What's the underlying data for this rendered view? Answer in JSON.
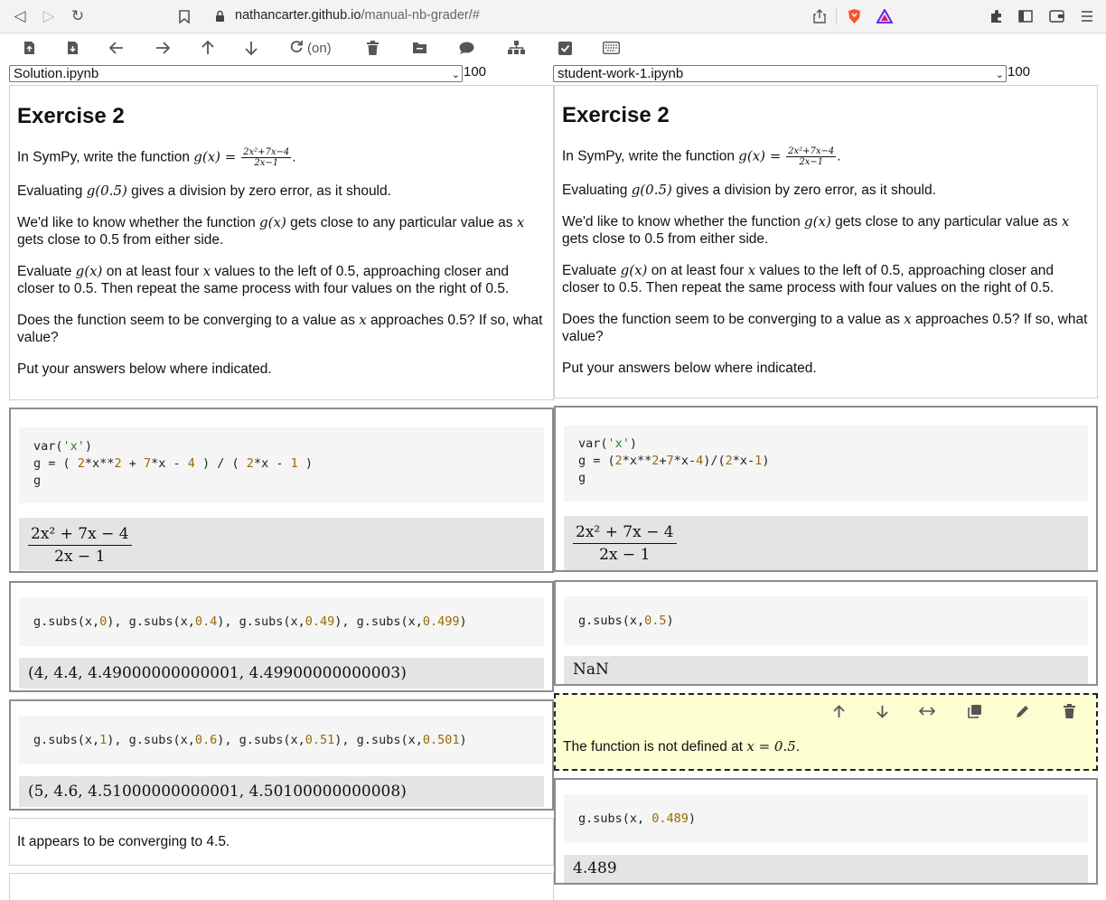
{
  "browser": {
    "url_host": "nathancarter.github.io",
    "url_path": "/manual-nb-grader/#"
  },
  "toolbar": {
    "autosave_label": "(on)"
  },
  "left_pane": {
    "notebook_file": "Solution.ipynb",
    "zoom": "100",
    "exercise": {
      "title": "Exercise 2",
      "p1_pre": "In SymPy, write the function ",
      "p1_fn": "g(x) = ",
      "p1_num": "2x²+7x−4",
      "p1_den": "2x−1",
      "p1_post": ".",
      "p2_pre": "Evaluating ",
      "p2_expr": "g(0.5)",
      "p2_post": " gives a division by zero error, as it should.",
      "p3_pre": "We'd like to know whether the function ",
      "p3_expr": "g(x)",
      "p3_mid": " gets close to any particular value as ",
      "p3_var": "x",
      "p3_post": " gets close to 0.5 from either side.",
      "p4_pre": "Evaluate ",
      "p4_expr": "g(x)",
      "p4_mid": " on at least four ",
      "p4_var": "x",
      "p4_post": " values to the left of 0.5, approaching closer and closer to 0.5. Then repeat the same process with four values on the right of 0.5.",
      "p5_pre": "Does the function seem to be converging to a value as ",
      "p5_var": "x",
      "p5_post": " approaches 0.5? If so, what value?",
      "p6": "Put your answers below where indicated."
    },
    "code1": {
      "line1_a": "var(",
      "line1_b": "'x'",
      "line1_c": ")",
      "line2_a": "g = ( ",
      "line2_b": "2",
      "line2_c": "*x**",
      "line2_d": "2",
      "line2_e": " + ",
      "line2_f": "7",
      "line2_g": "*x - ",
      "line2_h": "4",
      "line2_i": " ) / ( ",
      "line2_j": "2",
      "line2_k": "*x - ",
      "line2_l": "1",
      "line2_m": " )",
      "line3": "g",
      "out_num": "2x² + 7x − 4",
      "out_den": "2x − 1"
    },
    "code2": {
      "a": "g.subs(x,",
      "b": "0",
      "c": "), g.subs(x,",
      "d": "0.4",
      "e": "), g.subs(x,",
      "f": "0.49",
      "g": "), g.subs(x,",
      "h": "0.499",
      "i": ")",
      "out": "(4,  4.4,  4.49000000000001,  4.49900000000003)"
    },
    "code3": {
      "a": "g.subs(x,",
      "b": "1",
      "c": "), g.subs(x,",
      "d": "0.6",
      "e": "), g.subs(x,",
      "f": "0.51",
      "g": "), g.subs(x,",
      "h": "0.501",
      "i": ")",
      "out": "(5,  4.6,  4.51000000000001,  4.50100000000008)"
    },
    "answer_text": "It appears to be converging to 4.5."
  },
  "right_pane": {
    "notebook_file": "student-work-1.ipynb",
    "zoom": "100",
    "exercise": {
      "title": "Exercise 2",
      "p1_pre": "In SymPy, write the function ",
      "p1_fn": "g(x) = ",
      "p1_num": "2x²+7x−4",
      "p1_den": "2x−1",
      "p1_post": ".",
      "p2_pre": "Evaluating ",
      "p2_expr": "g(0.5)",
      "p2_post": " gives a division by zero error, as it should.",
      "p3_pre": "We'd like to know whether the function ",
      "p3_expr": "g(x)",
      "p3_mid": " gets close to any particular value as ",
      "p3_var": "x",
      "p3_post": " gets close to 0.5 from either side.",
      "p4_pre": "Evaluate ",
      "p4_expr": "g(x)",
      "p4_mid": " on at least four ",
      "p4_var": "x",
      "p4_post": " values to the left of 0.5, approaching closer and closer to 0.5. Then repeat the same process with four values on the right of 0.5.",
      "p5_pre": "Does the function seem to be converging to a value as ",
      "p5_var": "x",
      "p5_post": " approaches 0.5? If so, what value?",
      "p6": "Put your answers below where indicated."
    },
    "code1": {
      "line1_a": "var(",
      "line1_b": "'x'",
      "line1_c": ")",
      "line2_a": "g = (",
      "line2_b": "2",
      "line2_c": "*x**",
      "line2_d": "2",
      "line2_e": "+",
      "line2_f": "7",
      "line2_g": "*x-",
      "line2_h": "4",
      "line2_i": ")/(",
      "line2_j": "2",
      "line2_k": "*x-",
      "line2_l": "1",
      "line2_m": ")",
      "line3": "g",
      "out_num": "2x² + 7x − 4",
      "out_den": "2x − 1"
    },
    "code2": {
      "a": "g.subs(x,",
      "b": "0.5",
      "c": ")",
      "out": "NaN"
    },
    "note": {
      "text_pre": "The function is not defined at ",
      "text_math": "x = 0.5",
      "text_post": "."
    },
    "code3": {
      "a": "g.subs(x, ",
      "b": "0.489",
      "c": ")",
      "out": "4.489"
    }
  }
}
